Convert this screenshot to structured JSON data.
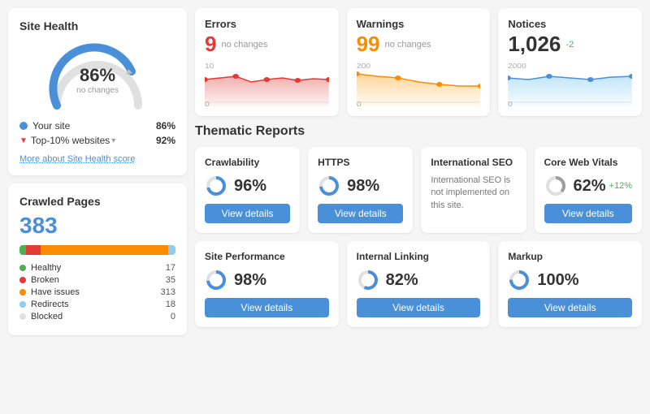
{
  "siteHealth": {
    "title": "Site Health",
    "percentage": "86%",
    "subLabel": "no changes",
    "yourSiteLabel": "Your site",
    "yourSiteVal": "86%",
    "topSiteLabel": "Top-10% websites",
    "topSiteVal": "92%",
    "moreLink": "More about Site Health score",
    "gaugeColor": "#4a90d9",
    "gaugeTrack": "#e0e0e0"
  },
  "crawledPages": {
    "title": "Crawled Pages",
    "count": "383",
    "legend": [
      {
        "label": "Healthy",
        "value": "17",
        "color": "#4caf50"
      },
      {
        "label": "Broken",
        "value": "35",
        "color": "#e53935"
      },
      {
        "label": "Have issues",
        "value": "313",
        "color": "#fb8c00"
      },
      {
        "label": "Redirects",
        "value": "18",
        "color": "#90caf9"
      },
      {
        "label": "Blocked",
        "value": "0",
        "color": "#e0e0e0"
      }
    ],
    "bar": [
      {
        "pct": 4.4,
        "color": "#4caf50"
      },
      {
        "pct": 9.1,
        "color": "#e53935"
      },
      {
        "pct": 81.7,
        "color": "#fb8c00"
      },
      {
        "pct": 4.7,
        "color": "#90caf9"
      },
      {
        "pct": 0.1,
        "color": "#e0e0e0"
      }
    ]
  },
  "metrics": [
    {
      "title": "Errors",
      "value": "9",
      "change": "no changes",
      "changeColor": "",
      "colorClass": "error",
      "chartColor": "#ef9a9a",
      "lineColor": "#e53935"
    },
    {
      "title": "Warnings",
      "value": "99",
      "change": "no changes",
      "changeColor": "",
      "colorClass": "warning",
      "chartColor": "#ffcc80",
      "lineColor": "#fb8c00"
    },
    {
      "title": "Notices",
      "value": "1,026",
      "change": "-2",
      "changeColor": "neg",
      "colorClass": "notice",
      "chartColor": "#b3e0f7",
      "lineColor": "#4a90d9"
    }
  ],
  "thematicReports": {
    "title": "Thematic Reports",
    "topRow": [
      {
        "name": "Crawlability",
        "pct": "96%",
        "change": "",
        "btnLabel": "View details",
        "desc": ""
      },
      {
        "name": "HTTPS",
        "pct": "98%",
        "change": "",
        "btnLabel": "View details",
        "desc": ""
      },
      {
        "name": "International SEO",
        "pct": "",
        "change": "",
        "btnLabel": "",
        "desc": "International SEO is not implemented on this site."
      },
      {
        "name": "Core Web Vitals",
        "pct": "62%",
        "change": "+12%",
        "btnLabel": "View details",
        "desc": ""
      }
    ],
    "bottomRow": [
      {
        "name": "Site Performance",
        "pct": "98%",
        "change": "",
        "btnLabel": "View details",
        "desc": ""
      },
      {
        "name": "Internal Linking",
        "pct": "82%",
        "change": "",
        "btnLabel": "View details",
        "desc": ""
      },
      {
        "name": "Markup",
        "pct": "100%",
        "change": "",
        "btnLabel": "View details",
        "desc": ""
      }
    ]
  }
}
